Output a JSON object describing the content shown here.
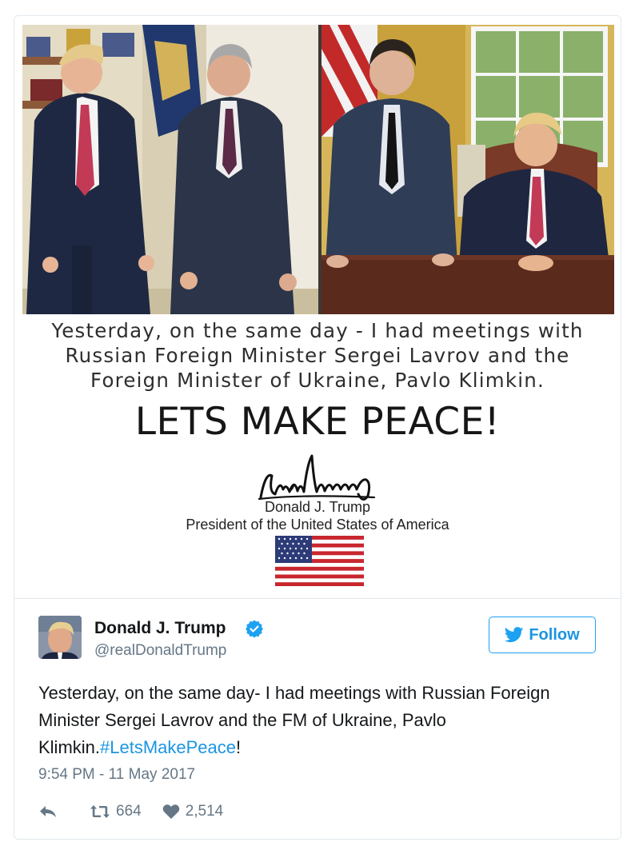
{
  "media": {
    "caption_lines": [
      "Yesterday, on the same day - I had meetings with",
      "Russian Foreign Minister Sergei Lavrov and the",
      "Foreign Minister of Ukraine, Pavlo Klimkin."
    ],
    "slogan": "LETS MAKE PEACE!",
    "signature_name": "Donald J. Trump",
    "signature_title": "President of the United States of America",
    "signature_script": "Donald Trump",
    "icons": {
      "flag": "us-flag-icon",
      "photos": "photo"
    }
  },
  "tweet": {
    "author_name": "Donald J. Trump",
    "author_handle": "@realDonaldTrump",
    "follow_label": "Follow",
    "text_main": "Yesterday, on the same day- I had meetings with Russian Foreign Minister Sergei Lavrov and the FM of Ukraine, Pavlo Klimkin.",
    "hashtag": "#LetsMakePeace",
    "text_tail": "!",
    "timestamp": "9:54 PM - 11 May 2017",
    "retweets": "664",
    "likes": "2,514"
  },
  "colors": {
    "link": "#1b95e0",
    "muted": "#657786",
    "text": "#14171a",
    "border": "#e1e8ed"
  }
}
